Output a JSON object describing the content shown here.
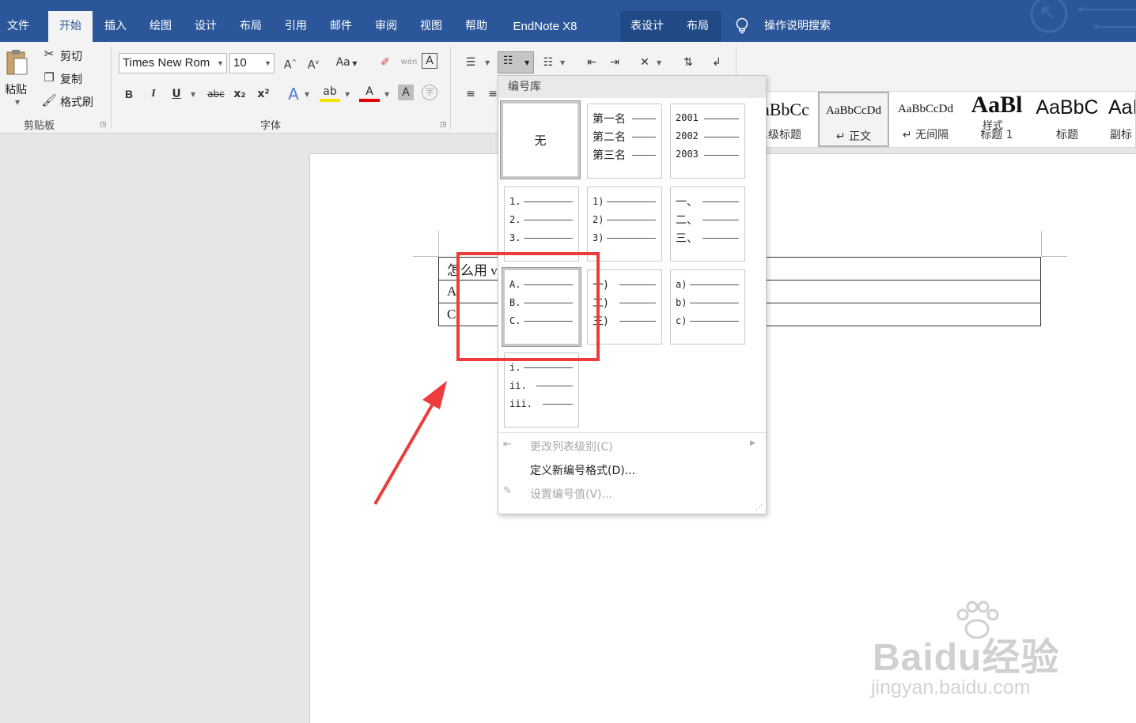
{
  "tabs": [
    {
      "label": "文件",
      "active": false
    },
    {
      "label": "开始",
      "active": true
    },
    {
      "label": "插入",
      "active": false
    },
    {
      "label": "绘图",
      "active": false
    },
    {
      "label": "设计",
      "active": false
    },
    {
      "label": "布局",
      "active": false
    },
    {
      "label": "引用",
      "active": false
    },
    {
      "label": "邮件",
      "active": false
    },
    {
      "label": "审阅",
      "active": false
    },
    {
      "label": "视图",
      "active": false
    },
    {
      "label": "帮助",
      "active": false
    },
    {
      "label": "EndNote X8",
      "active": false
    },
    {
      "label": "表设计",
      "active": false
    },
    {
      "label": "布局",
      "active": false
    }
  ],
  "tell_me": {
    "label": "操作说明搜索",
    "icon": "lightbulb-icon"
  },
  "clipboard": {
    "paste": "粘贴",
    "cut": "剪切",
    "copy": "复制",
    "format_painter": "格式刷",
    "group_label": "剪贴板"
  },
  "font": {
    "family": "Times New Rom",
    "size": "10",
    "group_label": "字体",
    "buttons": {
      "bold": "B",
      "italic": "I",
      "underline": "U",
      "strike": "abc",
      "subscript": "x₂",
      "superscript": "x²",
      "grow": "A",
      "shrink": "A",
      "case": "Aa",
      "effects": "A",
      "highlight": "ab",
      "color": "A",
      "shading": "A",
      "enclose": "字"
    }
  },
  "styles": {
    "group_label": "样式",
    "items": [
      {
        "sample": "AaBbCc",
        "name": "二级标题"
      },
      {
        "sample": "AaBbCcDd",
        "name": "↵ 正文",
        "selected": true
      },
      {
        "sample": "AaBbCcDd",
        "name": "↵ 无间隔"
      },
      {
        "sample": "AaBl",
        "name": "标题 1"
      },
      {
        "sample": "AaBbC",
        "name": "标题"
      },
      {
        "sample": "AaI",
        "name": "副标"
      }
    ]
  },
  "dropdown": {
    "header": "编号库",
    "none_label": "无",
    "tiles": [
      {
        "rows": [
          "第一名",
          "第二名",
          "第三名"
        ]
      },
      {
        "rows": [
          "2001",
          "2002",
          "2003"
        ]
      },
      {
        "rows": [
          "1.",
          "2.",
          "3."
        ]
      },
      {
        "rows": [
          "1)",
          "2)",
          "3)"
        ]
      },
      {
        "rows": [
          "一、",
          "二、",
          "三、"
        ]
      },
      {
        "rows": [
          "A.",
          "B.",
          "C."
        ]
      },
      {
        "rows": [
          "一)",
          "二)",
          "三)"
        ]
      },
      {
        "rows": [
          "a)",
          "b)",
          "c)"
        ]
      },
      {
        "rows": [
          "i.",
          "ii.",
          "iii."
        ]
      }
    ],
    "menu": [
      {
        "label": "更改列表级别(C)",
        "disabled": true
      },
      {
        "label": "定义新编号格式(D)...",
        "disabled": false
      },
      {
        "label": "设置编号值(V)...",
        "disabled": true
      }
    ]
  },
  "document": {
    "rows": [
      "怎么用 v",
      "A",
      "C"
    ]
  },
  "watermark": {
    "logo": "Baidu经验",
    "url": "jingyan.baidu.com"
  },
  "colors": {
    "accent": "#2b579a",
    "highlight": "#ee3b3b"
  }
}
